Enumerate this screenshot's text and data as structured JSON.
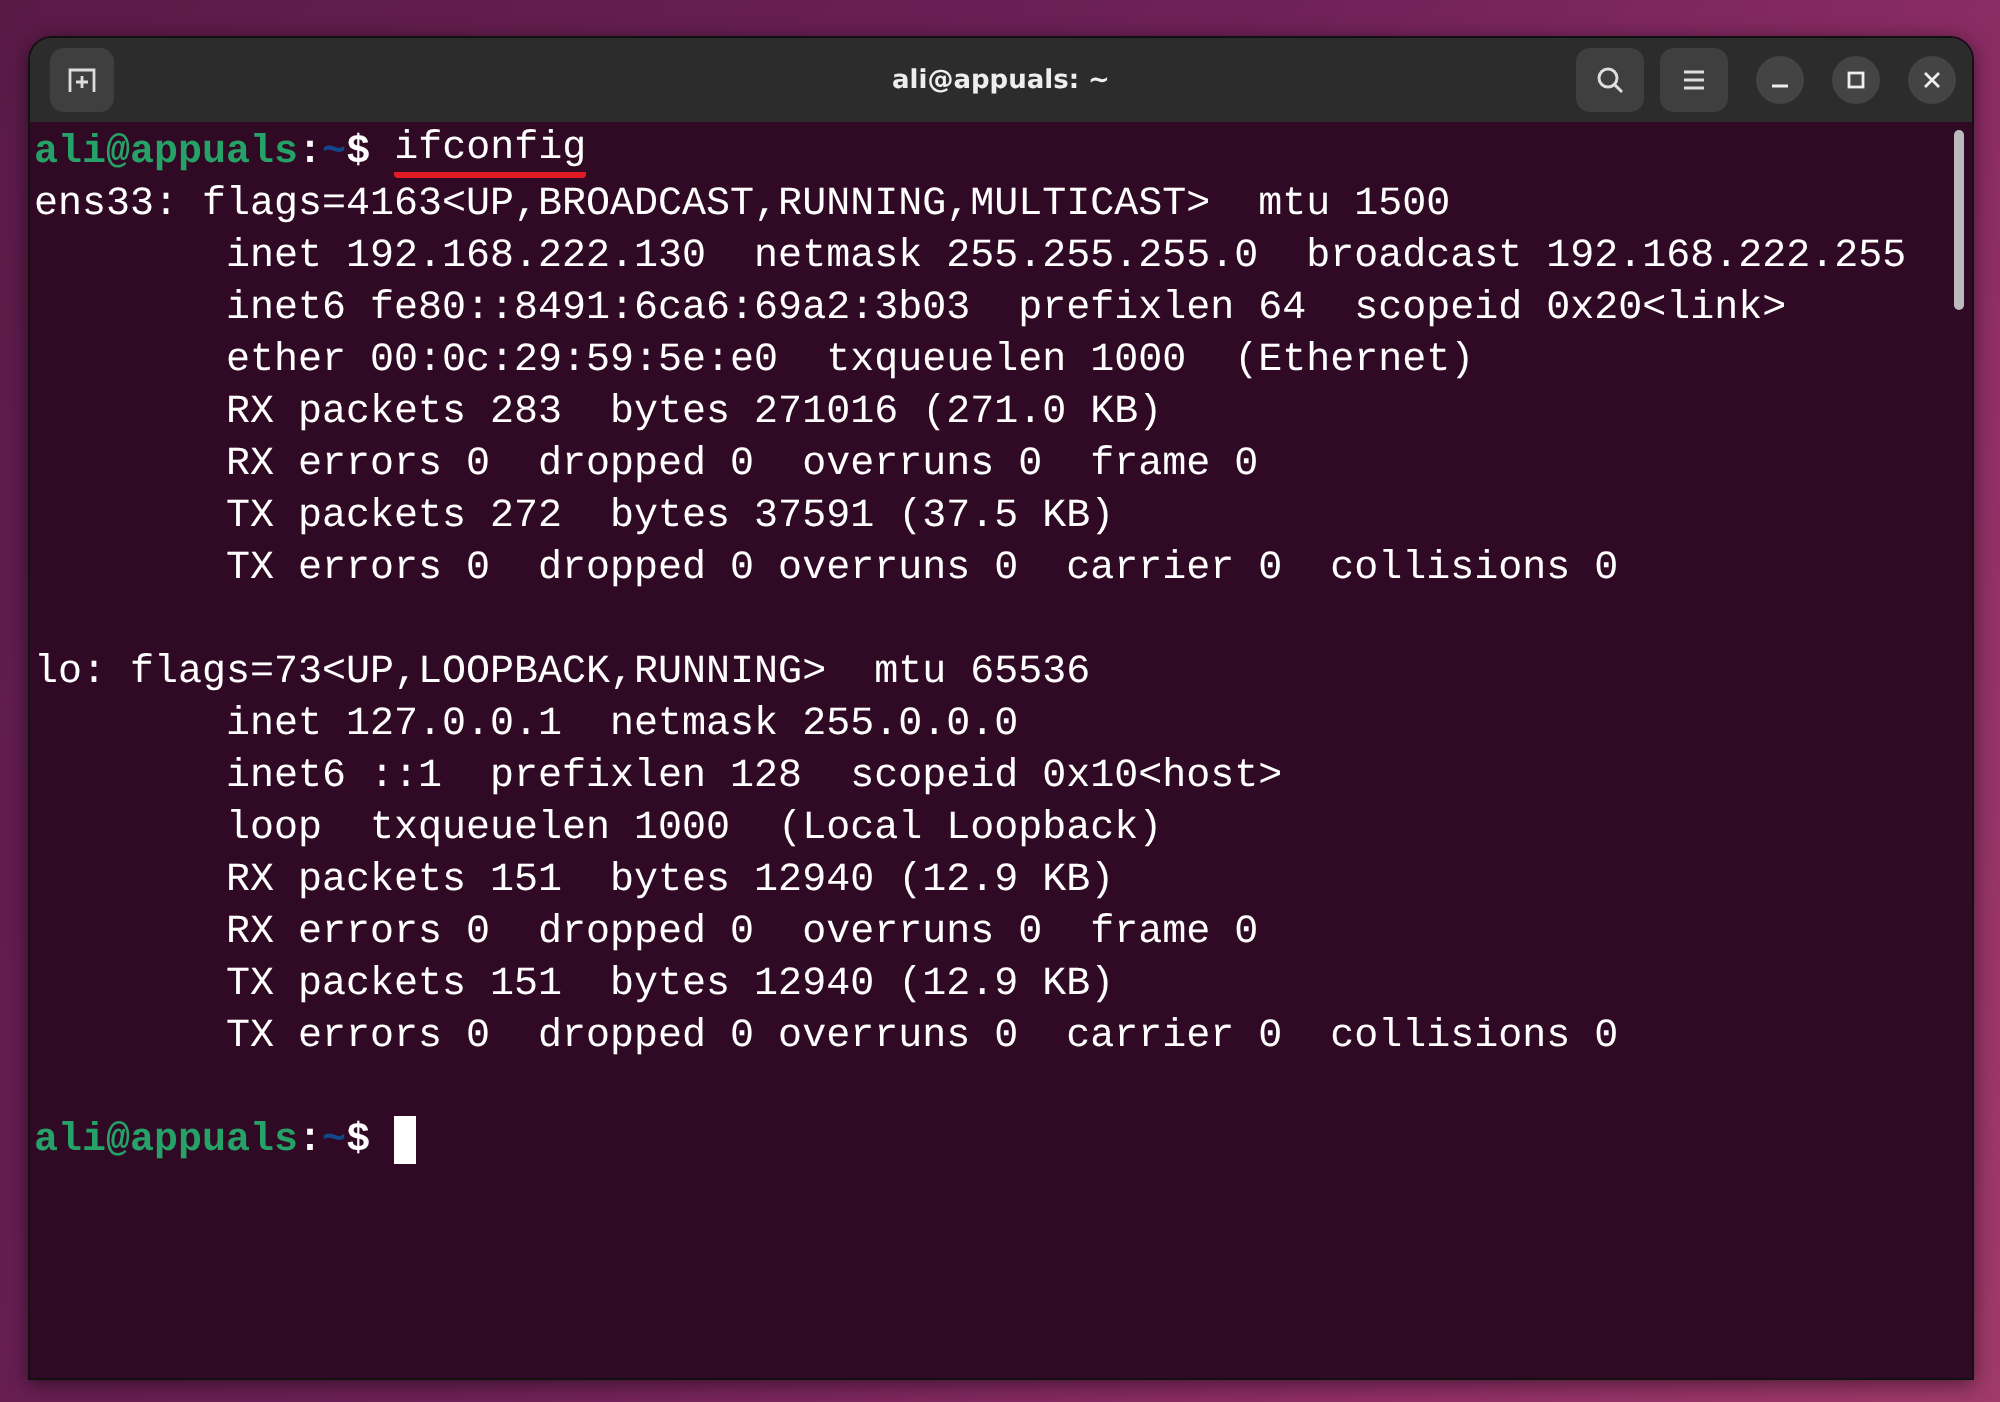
{
  "window": {
    "title": "ali@appuals: ~"
  },
  "terminal": {
    "lines": [
      {
        "kind": "prompt",
        "user": "ali@appuals",
        "separator": ":",
        "path": "~",
        "symbol": "$",
        "command": "ifconfig",
        "underlined": true,
        "cursor": false
      },
      {
        "kind": "output",
        "text": "ens33: flags=4163<UP,BROADCAST,RUNNING,MULTICAST>  mtu 1500"
      },
      {
        "kind": "output",
        "text": "        inet 192.168.222.130  netmask 255.255.255.0  broadcast 192.168.222.255"
      },
      {
        "kind": "output",
        "text": "        inet6 fe80::8491:6ca6:69a2:3b03  prefixlen 64  scopeid 0x20<link>"
      },
      {
        "kind": "output",
        "text": "        ether 00:0c:29:59:5e:e0  txqueuelen 1000  (Ethernet)"
      },
      {
        "kind": "output",
        "text": "        RX packets 283  bytes 271016 (271.0 KB)"
      },
      {
        "kind": "output",
        "text": "        RX errors 0  dropped 0  overruns 0  frame 0"
      },
      {
        "kind": "output",
        "text": "        TX packets 272  bytes 37591 (37.5 KB)"
      },
      {
        "kind": "output",
        "text": "        TX errors 0  dropped 0 overruns 0  carrier 0  collisions 0"
      },
      {
        "kind": "blank"
      },
      {
        "kind": "output",
        "text": "lo: flags=73<UP,LOOPBACK,RUNNING>  mtu 65536"
      },
      {
        "kind": "output",
        "text": "        inet 127.0.0.1  netmask 255.0.0.0"
      },
      {
        "kind": "output",
        "text": "        inet6 ::1  prefixlen 128  scopeid 0x10<host>"
      },
      {
        "kind": "output",
        "text": "        loop  txqueuelen 1000  (Local Loopback)"
      },
      {
        "kind": "output",
        "text": "        RX packets 151  bytes 12940 (12.9 KB)"
      },
      {
        "kind": "output",
        "text": "        RX errors 0  dropped 0  overruns 0  frame 0"
      },
      {
        "kind": "output",
        "text": "        TX packets 151  bytes 12940 (12.9 KB)"
      },
      {
        "kind": "output",
        "text": "        TX errors 0  dropped 0 overruns 0  carrier 0  collisions 0"
      },
      {
        "kind": "blank"
      },
      {
        "kind": "prompt",
        "user": "ali@appuals",
        "separator": ":",
        "path": "~",
        "symbol": "$",
        "cursor": true
      }
    ]
  }
}
